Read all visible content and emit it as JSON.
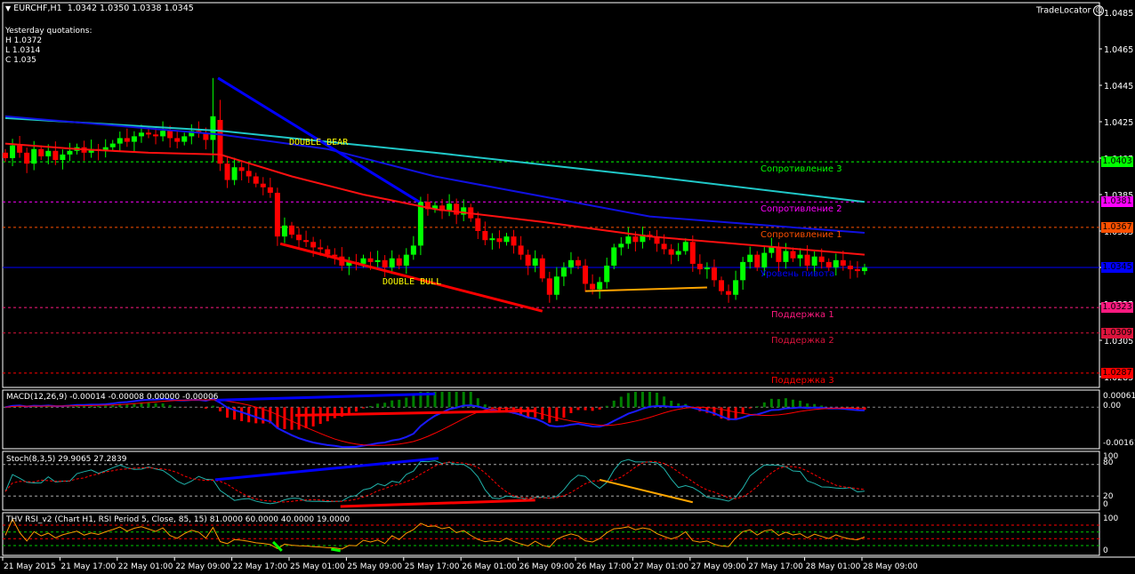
{
  "header": {
    "arrow_icon": "triangle-down",
    "symbol": "EURCHF,H1",
    "ohlc": "1.0342 1.0350 1.0338 1.0345"
  },
  "yesterday": {
    "title": "Yesterday quotations:",
    "high": "H 1.0372",
    "low": "L 1.0314",
    "close": "C 1.035"
  },
  "trade_locator": {
    "label": "TradeLocator",
    "icon": "sad-face"
  },
  "patterns": {
    "bear": "DOUBLE  BEAR",
    "bull": "DOUBLE  BULL"
  },
  "levels": [
    {
      "label": "Сопротивление 3",
      "value": 1.0403,
      "tag": "1.0403",
      "color": "#00ff00"
    },
    {
      "label": "Сопротивление 2",
      "value": 1.0381,
      "tag": "1.0381",
      "color": "#ff00ff"
    },
    {
      "label": "Сопротивление 1",
      "value": 1.0367,
      "tag": "1.0367",
      "color": "#ff5000"
    },
    {
      "label": "Уровень пивота",
      "value": 1.0345,
      "tag": "1.0345",
      "color": "#0000ff"
    },
    {
      "label": "Поддержка 1",
      "value": 1.0323,
      "tag": "1.0323",
      "color": "#ff1a80"
    },
    {
      "label": "Поддержка 2",
      "value": 1.0309,
      "tag": "1.0309",
      "color": "#dc143c"
    },
    {
      "label": "Поддержка 3",
      "value": 1.0287,
      "tag": "1.0287",
      "color": "#ff0000"
    }
  ],
  "macd": {
    "label": "MACD(12,26,9) -0.00014 -0.00008 0.00000 -0.00006",
    "ticks": [
      "0.00061",
      "0.00",
      "-0.00161"
    ]
  },
  "stoch": {
    "label": "Stoch(8,3,5) 29.9065 27.2839",
    "ticks": [
      "100",
      "80",
      "20",
      "0"
    ]
  },
  "rsi": {
    "label": "THV RSI_v2   (Chart H1,  RSI Period 5,  Close,  85,  15)   81.0000 60.0000 40.0000 19.0000",
    "ticks": [
      "100",
      "0"
    ]
  },
  "chart_data": {
    "type": "candlestick",
    "symbol": "EURCHF",
    "timeframe": "H1",
    "ylim": [
      1.0281,
      1.0491
    ],
    "price_ticks": [
      "1.0485",
      "1.0465",
      "1.0445",
      "1.0425",
      "1.0405",
      "1.0385",
      "1.0365",
      "1.0345",
      "1.0325",
      "1.0305",
      "1.0285"
    ],
    "time_labels": [
      "21 May 2015",
      "21 May 17:00",
      "22 May 01:00",
      "22 May 09:00",
      "22 May 17:00",
      "25 May 01:00",
      "25 May 09:00",
      "25 May 17:00",
      "26 May 01:00",
      "26 May 09:00",
      "26 May 17:00",
      "27 May 01:00",
      "27 May 09:00",
      "27 May 17:00",
      "28 May 01:00",
      "28 May 09:00"
    ],
    "bars_per_time_label": 8,
    "close": [
      1.0405,
      1.0412,
      1.0408,
      1.0402,
      1.041,
      1.0406,
      1.0409,
      1.0404,
      1.0407,
      1.0409,
      1.0411,
      1.0408,
      1.041,
      1.0409,
      1.0411,
      1.0413,
      1.0416,
      1.0414,
      1.0417,
      1.0419,
      1.0418,
      1.0417,
      1.042,
      1.0416,
      1.0414,
      1.0417,
      1.042,
      1.0419,
      1.0415,
      1.0428,
      1.0402,
      1.0393,
      1.04,
      1.0398,
      1.0395,
      1.0391,
      1.0389,
      1.0386,
      1.0362,
      1.0368,
      1.0363,
      1.036,
      1.0359,
      1.0356,
      1.0355,
      1.0352,
      1.0351,
      1.0346,
      1.0348,
      1.0347,
      1.035,
      1.0348,
      1.0349,
      1.0345,
      1.035,
      1.0346,
      1.0352,
      1.0357,
      1.0381,
      1.0377,
      1.0379,
      1.0376,
      1.038,
      1.0374,
      1.0378,
      1.0372,
      1.0365,
      1.036,
      1.0361,
      1.0359,
      1.0362,
      1.0357,
      1.0352,
      1.0346,
      1.035,
      1.0339,
      1.033,
      1.034,
      1.0345,
      1.0349,
      1.0346,
      1.0336,
      1.0333,
      1.0337,
      1.0346,
      1.0356,
      1.0358,
      1.0362,
      1.0359,
      1.0363,
      1.0362,
      1.0358,
      1.0355,
      1.0352,
      1.0354,
      1.0359,
      1.0347,
      1.0344,
      1.0345,
      1.0338,
      1.0332,
      1.033,
      1.0338,
      1.0348,
      1.0352,
      1.0345,
      1.0353,
      1.0356,
      1.0348,
      1.0354,
      1.035,
      1.0352,
      1.0346,
      1.0351,
      1.0348,
      1.0345,
      1.0349,
      1.0346,
      1.0344,
      1.0343,
      1.0345
    ],
    "spikes": [
      {
        "i": 29,
        "open": 1.0415,
        "high": 1.0449,
        "low": 1.0403
      },
      {
        "i": 30,
        "open": 1.0426,
        "high": 1.0437,
        "low": 1.0398
      }
    ],
    "ma": [
      {
        "name": "ma-cyan",
        "color": "#20c8c8",
        "points": [
          [
            0,
            1.0427
          ],
          [
            30,
            1.042
          ],
          [
            60,
            1.0408
          ],
          [
            90,
            1.0395
          ],
          [
            120,
            1.0381
          ]
        ]
      },
      {
        "name": "ma-blue",
        "color": "#1010e0",
        "points": [
          [
            0,
            1.0428
          ],
          [
            30,
            1.0418
          ],
          [
            45,
            1.041
          ],
          [
            60,
            1.0395
          ],
          [
            90,
            1.0373
          ],
          [
            120,
            1.0364
          ]
        ]
      },
      {
        "name": "ma-red",
        "color": "#ff1010",
        "points": [
          [
            0,
            1.0413
          ],
          [
            10,
            1.041
          ],
          [
            20,
            1.0408
          ],
          [
            30,
            1.0407
          ],
          [
            40,
            1.0395
          ],
          [
            50,
            1.0385
          ],
          [
            60,
            1.0377
          ],
          [
            75,
            1.037
          ],
          [
            90,
            1.0362
          ],
          [
            105,
            1.0357
          ],
          [
            120,
            1.0352
          ]
        ]
      }
    ],
    "trendlines": [
      {
        "name": "bear-trendline",
        "color": "#0000ff",
        "from": [
          29.7,
          1.0449
        ],
        "to": [
          57.8,
          1.0381
        ]
      },
      {
        "name": "bull-trendline",
        "color": "#ff0000",
        "from": [
          38.4,
          1.0358
        ],
        "to": [
          75,
          1.0321
        ]
      },
      {
        "name": "orange-trendline",
        "color": "#ffa500",
        "from": [
          81,
          1.0332
        ],
        "to": [
          98,
          1.0334
        ]
      }
    ],
    "macd_range": [
      -0.00161,
      0.00061
    ],
    "macd_annotations": [
      {
        "color": "#0000ff",
        "from": [
          29.5,
          0.00028
        ],
        "to": [
          60,
          0.00053
        ]
      },
      {
        "color": "#ff0000",
        "from": [
          40.5,
          -0.00032
        ],
        "to": [
          74,
          -0.00014
        ]
      }
    ],
    "stoch_annotations": [
      {
        "color": "#0000ff",
        "from": [
          29.3,
          51
        ],
        "to": [
          60.5,
          92
        ]
      },
      {
        "color": "#ff0000",
        "from": [
          46.8,
          0
        ],
        "to": [
          74,
          12
        ]
      },
      {
        "color": "#ffa500",
        "from": [
          83,
          51
        ],
        "to": [
          96,
          8
        ]
      }
    ],
    "rsi_levels": [
      81,
      60,
      40,
      19
    ],
    "rsi_annotations": [
      {
        "color": "#00ff00",
        "from": [
          37.4,
          30
        ],
        "to": [
          38.6,
          3
        ]
      },
      {
        "color": "#00ff00",
        "from": [
          45.5,
          8
        ],
        "to": [
          46.8,
          3
        ]
      }
    ]
  }
}
